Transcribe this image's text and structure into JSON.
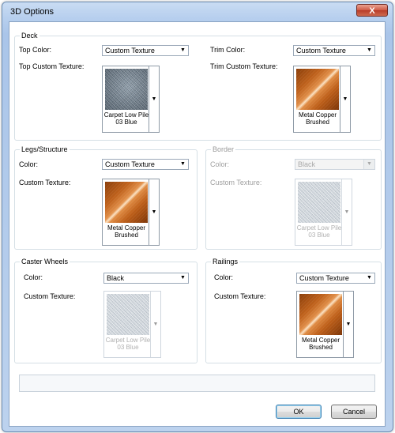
{
  "window": {
    "title": "3D Options",
    "close_label": "X"
  },
  "deck": {
    "legend": "Deck",
    "top_color_label": "Top Color:",
    "top_color_value": "Custom Texture",
    "top_texture_label": "Top Custom Texture:",
    "top_texture_name": "Carpet Low Pile 03 Blue",
    "trim_color_label": "Trim Color:",
    "trim_color_value": "Custom Texture",
    "trim_texture_label": "Trim Custom Texture:",
    "trim_texture_name": "Metal Copper Brushed"
  },
  "legs": {
    "legend": "Legs/Structure",
    "color_label": "Color:",
    "color_value": "Custom Texture",
    "texture_label": "Custom Texture:",
    "texture_name": "Metal Copper Brushed"
  },
  "border": {
    "legend": "Border",
    "color_label": "Color:",
    "color_value": "Black",
    "texture_label": "Custom Texture:",
    "texture_name": "Carpet Low Pile 03 Blue"
  },
  "caster": {
    "legend": "Caster Wheels",
    "color_label": "Color:",
    "color_value": "Black",
    "texture_label": "Custom Texture:",
    "texture_name": "Carpet Low Pile 03 Blue"
  },
  "railings": {
    "legend": "Railings",
    "color_label": "Color:",
    "color_value": "Custom Texture",
    "texture_label": "Custom Texture:",
    "texture_name": "Metal Copper Brushed"
  },
  "buttons": {
    "ok": "OK",
    "cancel": "Cancel"
  },
  "colors": {
    "titlebar": "#b7cfee",
    "close": "#cf5a44",
    "copper": "#c0621c",
    "carpet": "#6e7c89"
  },
  "icons": {
    "dropdown": "triangle-down",
    "close": "x-mark"
  }
}
